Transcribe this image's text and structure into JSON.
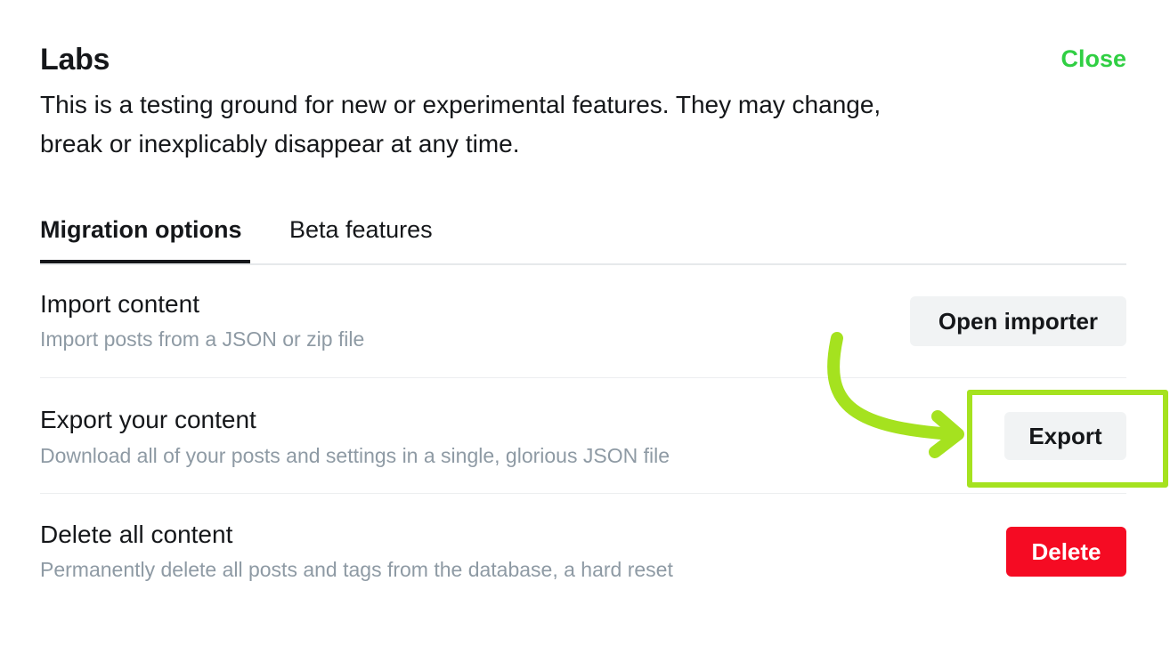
{
  "header": {
    "title": "Labs",
    "close_label": "Close",
    "description": "This is a testing ground for new or experimental features. They may change, break or inexplicably disappear at any time."
  },
  "tabs": [
    {
      "label": "Migration options",
      "active": true
    },
    {
      "label": "Beta features",
      "active": false
    }
  ],
  "rows": [
    {
      "title": "Import content",
      "subtitle": "Import posts from a JSON or zip file",
      "button_label": "Open importer"
    },
    {
      "title": "Export your content",
      "subtitle": "Download all of your posts and settings in a single, glorious JSON file",
      "button_label": "Export"
    },
    {
      "title": "Delete all content",
      "subtitle": "Permanently delete all posts and tags from the database, a hard reset",
      "button_label": "Delete"
    }
  ],
  "colors": {
    "accent_green": "#30cf43",
    "danger_red": "#f50b23",
    "annotation_lime": "#a5e21f"
  },
  "icons": {
    "annotation": "curved-arrow-icon"
  }
}
